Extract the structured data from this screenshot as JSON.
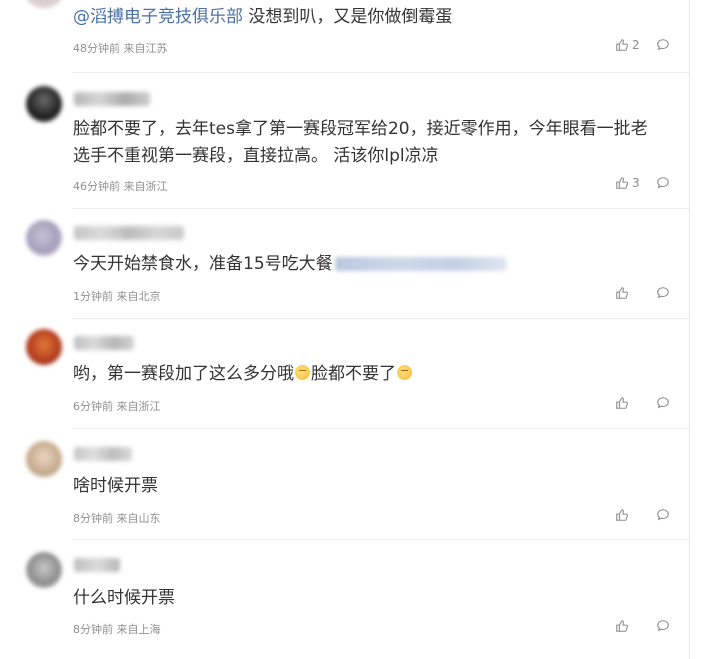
{
  "comments": [
    {
      "mention": "@滔搏电子竞技俱乐部",
      "text": " 没想到叭，又是你做倒霉蛋",
      "time": "48分钟前",
      "location": "来自江苏",
      "likes": "2"
    },
    {
      "line1": "脸都不要了，去年tes拿了第一赛段冠军给20，接近零作用，今年眼看一批老",
      "line2": "选手不重视第一赛段，直接拉高。 活该你lpl凉凉",
      "time": "46分钟前",
      "location": "来自浙江",
      "likes": "3"
    },
    {
      "text": "今天开始禁食水，准备15号吃大餐",
      "time": "1分钟前",
      "location": "来自北京",
      "likes": ""
    },
    {
      "text_a": "哟，第一赛段加了这么多分哦",
      "text_b": "脸都不要了",
      "time": "6分钟前",
      "location": "来自浙江",
      "likes": ""
    },
    {
      "text": "啥时候开票",
      "time": "8分钟前",
      "location": "来自山东",
      "likes": ""
    },
    {
      "text": "什么时候开票",
      "time": "8分钟前",
      "location": "来自上海",
      "likes": ""
    }
  ],
  "icons": {
    "like": "thumbs-up-icon",
    "reply": "comment-bubble-icon"
  },
  "colors": {
    "mention": "#4a6fa5",
    "text": "#333333",
    "meta": "#909090",
    "divider": "#ececec"
  }
}
